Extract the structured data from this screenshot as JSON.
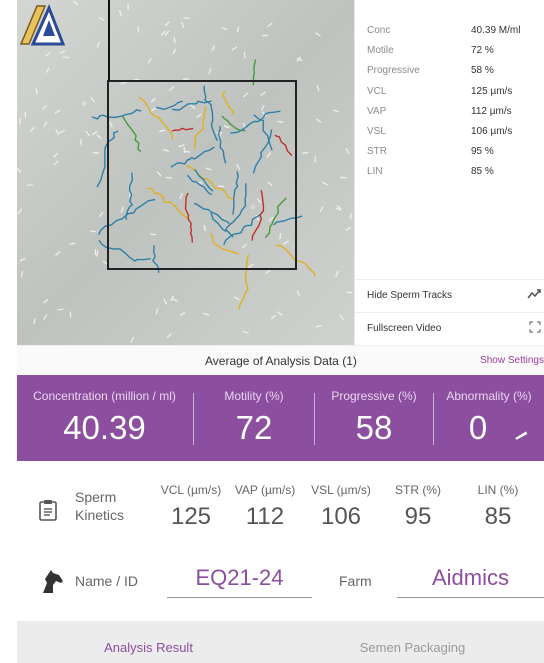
{
  "stats": {
    "rows": [
      {
        "label": "Conc",
        "value": "40.39 M/ml"
      },
      {
        "label": "Motile",
        "value": "72 %"
      },
      {
        "label": "Progressive",
        "value": "58 %"
      },
      {
        "label": "VCL",
        "value": "125 µm/s"
      },
      {
        "label": "VAP",
        "value": "112 µm/s"
      },
      {
        "label": "VSL",
        "value": "106 µm/s"
      },
      {
        "label": "STR",
        "value": "95 %"
      },
      {
        "label": "LIN",
        "value": "85 %"
      }
    ],
    "hide_tracks_label": "Hide Sperm Tracks",
    "hide_tracks_icon": "trend-line-icon",
    "fullscreen_label": "Fullscreen Video",
    "fullscreen_icon": "expand-icon"
  },
  "average": {
    "title": "Average of Analysis Data (1)",
    "show_settings": "Show Settings"
  },
  "metrics": [
    {
      "label": "Concentration (million / ml)",
      "value": "40.39"
    },
    {
      "label": "Motility (%)",
      "value": "72"
    },
    {
      "label": "Progressive (%)",
      "value": "58"
    },
    {
      "label": "Abnormality (%)",
      "value": "0"
    }
  ],
  "kinetics": {
    "title": "Sperm Kinetics",
    "columns": [
      {
        "label": "VCL (µm/s)",
        "value": "125"
      },
      {
        "label": "VAP (µm/s)",
        "value": "112"
      },
      {
        "label": "VSL (µm/s)",
        "value": "106"
      },
      {
        "label": "STR (%)",
        "value": "95"
      },
      {
        "label": "LIN (%)",
        "value": "85"
      }
    ]
  },
  "identity": {
    "name_label": "Name / ID",
    "name_value": "EQ21-24",
    "farm_label": "Farm",
    "farm_value": "Aidmics"
  },
  "tabs": [
    {
      "label": "Analysis Result",
      "active": true
    },
    {
      "label": "Semen Packaging",
      "active": false
    }
  ],
  "colors": {
    "accent": "#8c4e9e",
    "track_blue": "#2f7fa8",
    "track_yellow": "#e0b020",
    "track_red": "#c0302a",
    "track_green": "#4a9a3a"
  }
}
